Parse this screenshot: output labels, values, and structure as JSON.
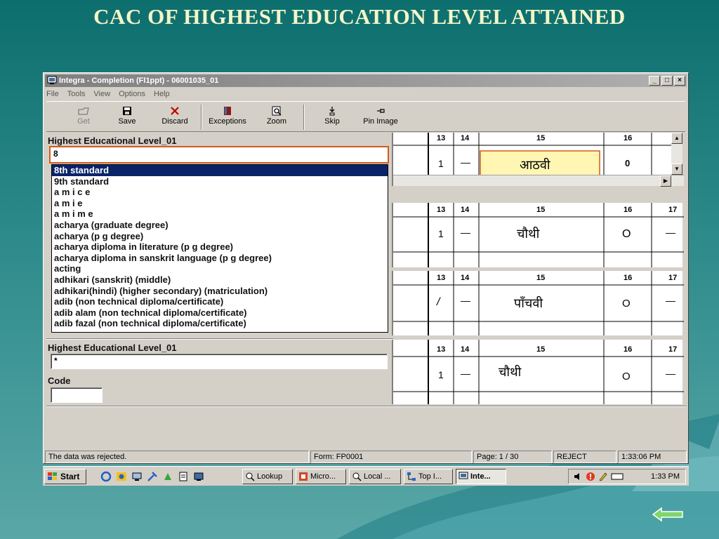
{
  "slide": {
    "title": "CAC OF HIGHEST EDUCATION LEVEL ATTAINED"
  },
  "window": {
    "title": "Integra - Completion (Fl1ppt) - 06001035_01"
  },
  "menu": [
    "File",
    "Tools",
    "View",
    "Options",
    "Help"
  ],
  "toolbar": {
    "get": "Get",
    "save": "Save",
    "discard": "Discard",
    "exceptions": "Exceptions",
    "zoom": "Zoom",
    "skip": "Skip",
    "pin_image": "Pin Image"
  },
  "field1": {
    "label": "Highest Educational Level_01",
    "value": "8"
  },
  "dropdown": [
    "8th standard",
    "9th standard",
    "a m i c e",
    "a m i e",
    "a m i m e",
    "acharya (graduate degree)",
    "acharya (p g degree)",
    "acharya diploma in literature (p g degree)",
    "acharya diploma in sanskrit language (p g degree)",
    "acting",
    "adhikari (sanskrit) (middle)",
    "adhikari(hindi) (higher secondary) (matriculation)",
    "adib (non technical diploma/certificate)",
    "adib alam (non technical diploma/certificate)",
    "adib fazal (non technical diploma/certificate)"
  ],
  "field2": {
    "label": "Highest Educational Level_01",
    "value": "*"
  },
  "code": {
    "label": "Code",
    "value": ""
  },
  "form_images": {
    "col_headers": [
      "13",
      "14",
      "15",
      "16",
      "17"
    ],
    "rows": [
      {
        "c13": "1",
        "c14": "—",
        "c15": "आठवी",
        "c16": "0",
        "c17": ""
      },
      {
        "c13": "1",
        "c14": "—",
        "c15": "चौथी",
        "c16": "O",
        "c17": "—"
      },
      {
        "c13": "/",
        "c14": "—",
        "c15": "पाँचवी",
        "c16": "O",
        "c17": "—"
      },
      {
        "c13": "1",
        "c14": "—",
        "c15": "चौथी",
        "c16": "O",
        "c17": "—"
      }
    ]
  },
  "status": {
    "message": "The data was rejected.",
    "form": "Form: FP0001",
    "page": "Page: 1 / 30",
    "state": "REJECT",
    "time": "1:33:06 PM"
  },
  "taskbar": {
    "start": "Start",
    "tasks": [
      "Lookup",
      "Micro...",
      "Local ...",
      "Top I...",
      "Inte..."
    ],
    "clock": "1:33 PM"
  }
}
